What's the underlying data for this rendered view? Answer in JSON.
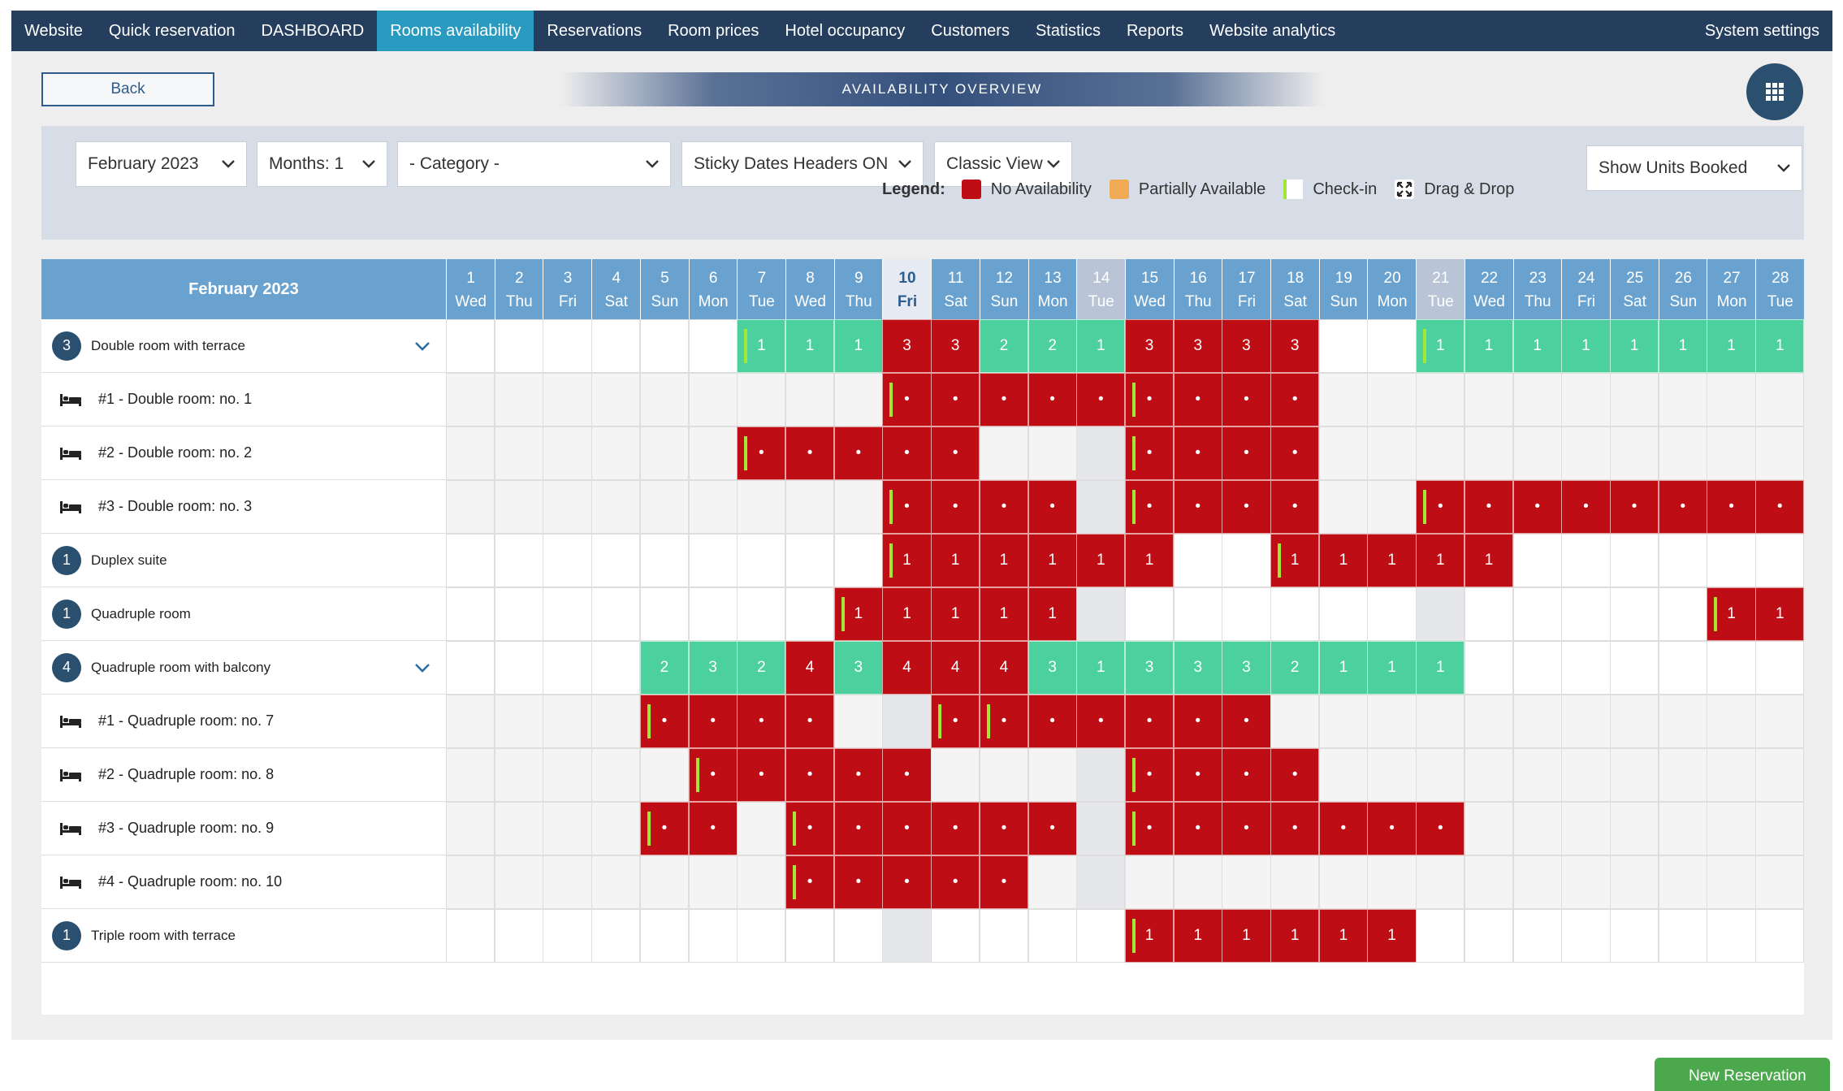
{
  "nav": {
    "items": [
      "Website",
      "Quick reservation",
      "DASHBOARD",
      "Rooms availability",
      "Reservations",
      "Room prices",
      "Hotel occupancy",
      "Customers",
      "Statistics",
      "Reports",
      "Website analytics"
    ],
    "active_index": 3,
    "settings": "System settings"
  },
  "back_label": "Back",
  "title": "AVAILABILITY OVERVIEW",
  "filters": {
    "month": "February 2023",
    "months": "Months: 1",
    "category": "- Category -",
    "sticky": "Sticky Dates Headers ON",
    "view": "Classic View",
    "units": "Show Units Booked"
  },
  "legend": {
    "title": "Legend:",
    "items": [
      {
        "label": "No Availability",
        "color": "#bf0d16"
      },
      {
        "label": "Partially Available",
        "color": "#f1ab57"
      },
      {
        "label": "Check-in",
        "color": "#ffffff"
      },
      {
        "label": "Drag & Drop",
        "color": "#ffffff"
      }
    ]
  },
  "calendar": {
    "month_header": "February 2023",
    "days": [
      {
        "d": "1",
        "w": "Wed"
      },
      {
        "d": "2",
        "w": "Thu"
      },
      {
        "d": "3",
        "w": "Fri"
      },
      {
        "d": "4",
        "w": "Sat"
      },
      {
        "d": "5",
        "w": "Sun"
      },
      {
        "d": "6",
        "w": "Mon"
      },
      {
        "d": "7",
        "w": "Tue"
      },
      {
        "d": "8",
        "w": "Wed"
      },
      {
        "d": "9",
        "w": "Thu"
      },
      {
        "d": "10",
        "w": "Fri"
      },
      {
        "d": "11",
        "w": "Sat"
      },
      {
        "d": "12",
        "w": "Sun"
      },
      {
        "d": "13",
        "w": "Mon"
      },
      {
        "d": "14",
        "w": "Tue"
      },
      {
        "d": "15",
        "w": "Wed"
      },
      {
        "d": "16",
        "w": "Thu"
      },
      {
        "d": "17",
        "w": "Fri"
      },
      {
        "d": "18",
        "w": "Sat"
      },
      {
        "d": "19",
        "w": "Sun"
      },
      {
        "d": "20",
        "w": "Mon"
      },
      {
        "d": "21",
        "w": "Tue"
      },
      {
        "d": "22",
        "w": "Wed"
      },
      {
        "d": "23",
        "w": "Thu"
      },
      {
        "d": "24",
        "w": "Fri"
      },
      {
        "d": "25",
        "w": "Sat"
      },
      {
        "d": "26",
        "w": "Sun"
      },
      {
        "d": "27",
        "w": "Mon"
      },
      {
        "d": "28",
        "w": "Tue"
      }
    ],
    "highlight_day": 10,
    "muted_days": [
      14,
      21
    ],
    "rows": [
      {
        "type": "cat",
        "count": "3",
        "label": "Double room with terrace",
        "expandable": true,
        "cells": [
          "e",
          "e",
          "e",
          "e",
          "e",
          "e",
          "t:1:ci",
          "t:1",
          "t:1",
          "r:3",
          "r:3",
          "t:2",
          "t:2",
          "t:1",
          "r:3",
          "r:3",
          "r:3",
          "r:3",
          "e",
          "e",
          "t:1:ci",
          "t:1",
          "t:1",
          "t:1",
          "t:1",
          "t:1",
          "t:1",
          "t:1"
        ]
      },
      {
        "type": "unit",
        "label": "#1 - Double room: no. 1",
        "cells": [
          "g",
          "g",
          "g",
          "g",
          "g",
          "g",
          "g",
          "g",
          "g",
          "r:•:ci",
          "r:•",
          "r:•",
          "r:•",
          "r:•",
          "r:•:ci",
          "r:•",
          "r:•",
          "r:•",
          "g",
          "g",
          "g",
          "g",
          "g",
          "g",
          "g",
          "g",
          "g",
          "g"
        ]
      },
      {
        "type": "unit",
        "label": "#2 - Double room: no. 2",
        "cells": [
          "g",
          "g",
          "g",
          "g",
          "g",
          "g",
          "r:•:ci",
          "r:•",
          "r:•",
          "r:•",
          "r:•",
          "g",
          "g",
          "x",
          "r:•:ci",
          "r:•",
          "r:•",
          "r:•",
          "g",
          "g",
          "g",
          "g",
          "g",
          "g",
          "g",
          "g",
          "g",
          "g"
        ]
      },
      {
        "type": "unit",
        "label": "#3 - Double room: no. 3",
        "cells": [
          "g",
          "g",
          "g",
          "g",
          "g",
          "g",
          "g",
          "g",
          "g",
          "r:•:ci",
          "r:•",
          "r:•",
          "r:•",
          "x",
          "r:•:ci",
          "r:•",
          "r:•",
          "r:•",
          "g",
          "g",
          "r:•:ci",
          "r:•",
          "r:•",
          "r:•",
          "r:•",
          "r:•",
          "r:•",
          "r:•"
        ]
      },
      {
        "type": "cat",
        "count": "1",
        "label": "Duplex suite",
        "expandable": false,
        "cells": [
          "e",
          "e",
          "e",
          "e",
          "e",
          "e",
          "e",
          "e",
          "e",
          "r:1:ci",
          "r:1",
          "r:1",
          "r:1",
          "r:1",
          "r:1",
          "e",
          "e",
          "r:1:ci",
          "r:1",
          "r:1",
          "r:1",
          "r:1",
          "e",
          "e",
          "e",
          "e",
          "e",
          "e"
        ]
      },
      {
        "type": "cat",
        "count": "1",
        "label": "Quadruple room",
        "expandable": false,
        "cells": [
          "e",
          "e",
          "e",
          "e",
          "e",
          "e",
          "e",
          "e",
          "r:1:ci",
          "r:1",
          "r:1",
          "r:1",
          "r:1",
          "x",
          "e",
          "e",
          "e",
          "e",
          "e",
          "e",
          "x",
          "e",
          "e",
          "e",
          "e",
          "e",
          "r:1:ci",
          "r:1"
        ]
      },
      {
        "type": "cat",
        "count": "4",
        "label": "Quadruple room with balcony",
        "expandable": true,
        "cells": [
          "e",
          "e",
          "e",
          "e",
          "t:2",
          "t:3",
          "t:2",
          "r:4",
          "t:3",
          "r:4",
          "r:4",
          "r:4",
          "t:3",
          "t:1",
          "t:3",
          "t:3",
          "t:3",
          "t:2",
          "t:1",
          "t:1",
          "t:1",
          "e",
          "e",
          "e",
          "e",
          "e",
          "e",
          "e"
        ]
      },
      {
        "type": "unit",
        "label": "#1 - Quadruple room: no. 7",
        "cells": [
          "g",
          "g",
          "g",
          "g",
          "r:•:ci",
          "r:•",
          "r:•",
          "r:•",
          "g",
          "x",
          "r:•:ci",
          "r:•:ci",
          "r:•",
          "r:•",
          "r:•",
          "r:•",
          "r:•",
          "g",
          "g",
          "g",
          "g",
          "g",
          "g",
          "g",
          "g",
          "g",
          "g",
          "g"
        ]
      },
      {
        "type": "unit",
        "label": "#2 - Quadruple room: no. 8",
        "cells": [
          "g",
          "g",
          "g",
          "g",
          "g",
          "r:•:ci",
          "r:•",
          "r:•",
          "r:•",
          "r:•",
          "g",
          "g",
          "g",
          "x",
          "r:•:ci",
          "r:•",
          "r:•",
          "r:•",
          "g",
          "g",
          "g",
          "g",
          "g",
          "g",
          "g",
          "g",
          "g",
          "g"
        ]
      },
      {
        "type": "unit",
        "label": "#3 - Quadruple room: no. 9",
        "cells": [
          "g",
          "g",
          "g",
          "g",
          "r:•:ci",
          "r:•",
          "g",
          "r:•:ci",
          "r:•",
          "r:•",
          "r:•",
          "r:•",
          "r:•",
          "x",
          "r:•:ci",
          "r:•",
          "r:•",
          "r:•",
          "r:•",
          "r:•",
          "r:•",
          "g",
          "g",
          "g",
          "g",
          "g",
          "g",
          "g"
        ]
      },
      {
        "type": "unit",
        "label": "#4 - Quadruple room: no. 10",
        "cells": [
          "g",
          "g",
          "g",
          "g",
          "g",
          "g",
          "g",
          "r:•:ci",
          "r:•",
          "r:•",
          "r:•",
          "r:•",
          "g",
          "x",
          "g",
          "g",
          "g",
          "g",
          "g",
          "g",
          "g",
          "g",
          "g",
          "g",
          "g",
          "g",
          "g",
          "g"
        ]
      },
      {
        "type": "cat",
        "count": "1",
        "label": "Triple room with terrace",
        "expandable": false,
        "cells": [
          "e",
          "e",
          "e",
          "e",
          "e",
          "e",
          "e",
          "e",
          "e",
          "x",
          "e",
          "e",
          "e",
          "e",
          "r:1:ci",
          "r:1",
          "r:1",
          "r:1",
          "r:1",
          "r:1",
          "e",
          "e",
          "e",
          "e",
          "e",
          "e",
          "e",
          "e"
        ]
      }
    ]
  },
  "new_reservation": "New Reservation",
  "colors": {
    "nav_bg": "#253e5e",
    "nav_active": "#2a9bc0",
    "no_availability": "#bf0d16",
    "available": "#4bd09e",
    "checkin_marker": "#a3e635",
    "header_blue": "#6aa2cf"
  }
}
